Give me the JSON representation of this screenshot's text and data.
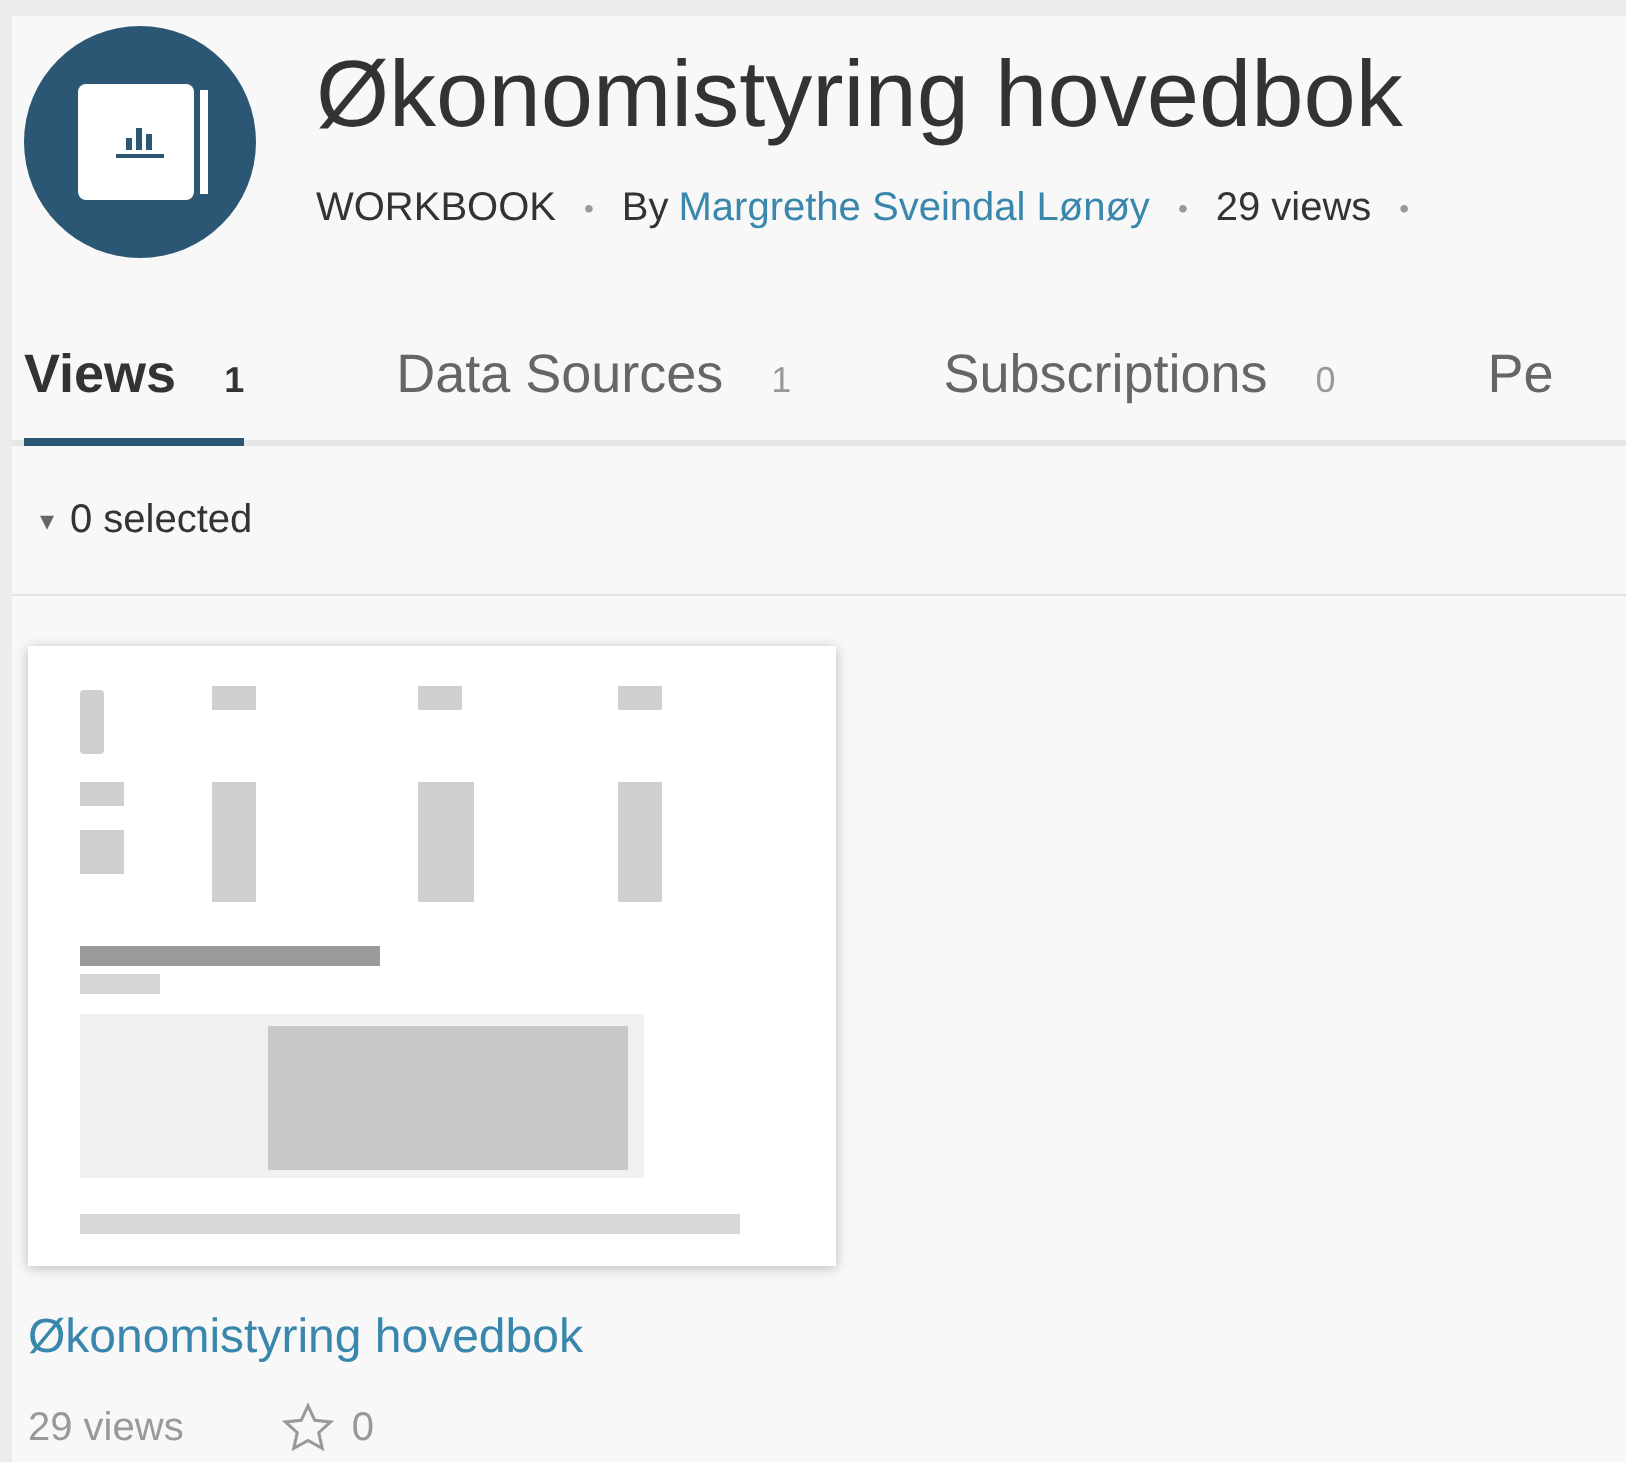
{
  "workbook": {
    "title": "Økonomistyring hovedbok",
    "type_label": "WORKBOOK",
    "by_prefix": "By",
    "owner": "Margrethe Sveindal Lønøy",
    "views": "29 views",
    "separator": "•"
  },
  "tabs": [
    {
      "label": "Views",
      "count": "1",
      "selected": true
    },
    {
      "label": "Data Sources",
      "count": "1",
      "selected": false
    },
    {
      "label": "Subscriptions",
      "count": "0",
      "selected": false
    },
    {
      "label": "Pe",
      "selected": false
    }
  ],
  "selection": {
    "caret": "▾",
    "label": "0 selected"
  },
  "views": [
    {
      "title": "Økonomistyring hovedbok",
      "views": "29 views",
      "favorites": "0",
      "favorited": false
    }
  ]
}
